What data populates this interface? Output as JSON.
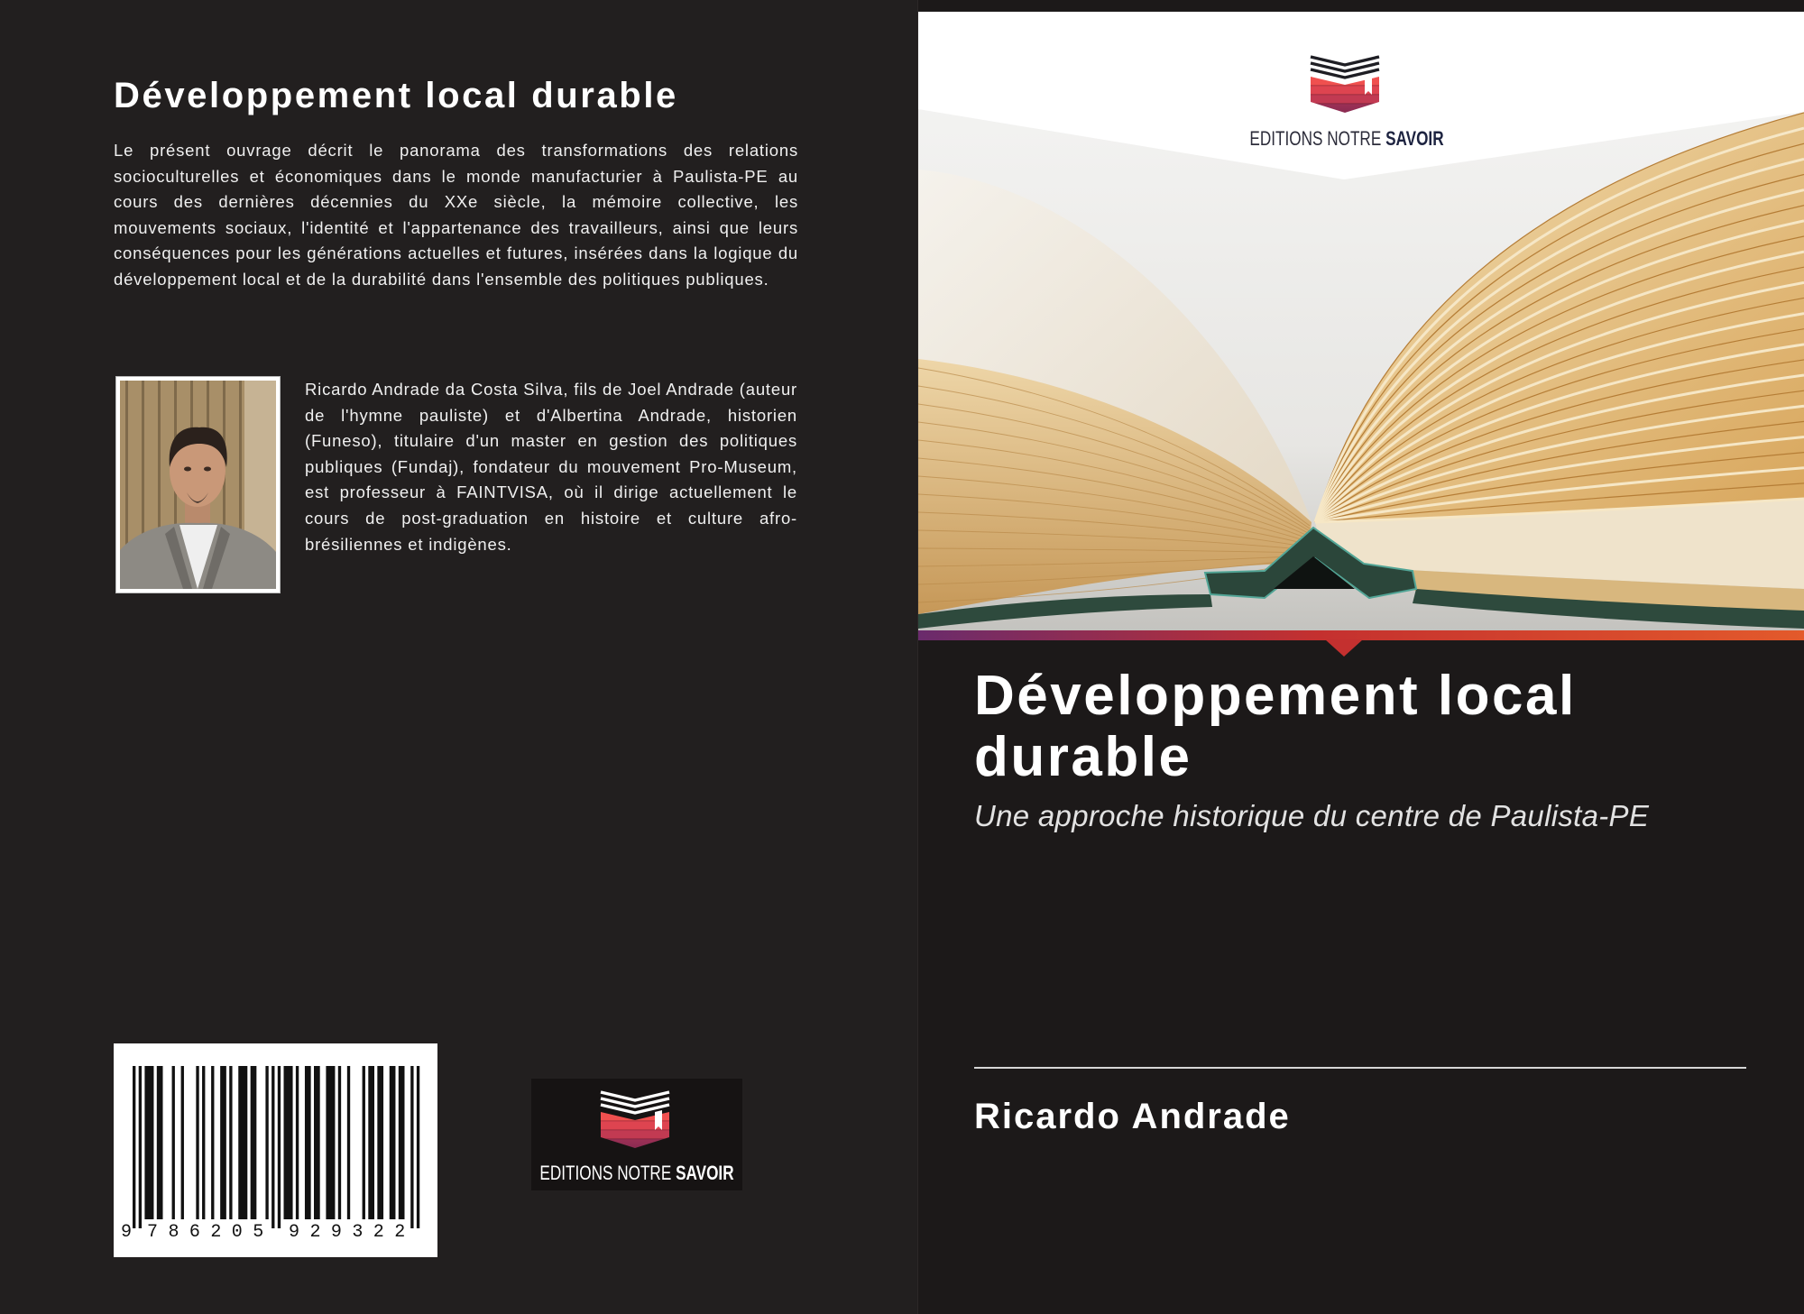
{
  "publisher": {
    "name_light": "EDITIONS NOTRE",
    "name_bold": "SAVOIR",
    "icon": "open-book-stack-icon"
  },
  "back_cover": {
    "title": "Développement local durable",
    "summary": "Le présent ouvrage décrit le panorama des transformations des relations socioculturelles et économiques dans le monde manufacturier à Paulista-PE au cours des dernières décennies du XXe siècle, la mémoire collective, les mouvements sociaux, l'identité et l'appartenance des travailleurs, ainsi que leurs conséquences pour les générations actuelles et futures, insérées dans la logique du développement local et de la durabilité dans l'ensemble des politiques publiques.",
    "author_bio": "Ricardo Andrade da Costa Silva, fils de Joel Andrade (auteur de l'hymne pauliste) et d'Albertina Andrade, historien (Funeso), titulaire d'un master en gestion des politiques publiques (Fundaj), fondateur du mouvement Pro-Museum, est professeur à FAINTVISA, où il dirige actuellement le cours de post-graduation en histoire et culture afro-brésiliennes et indigènes.",
    "barcode": {
      "first_digit": "9",
      "left_group": "786205",
      "right_group": "929322"
    }
  },
  "front_cover": {
    "title": "Développement local durable",
    "subtitle": "Une approche historique du centre de Paulista-PE",
    "author": "Ricardo Andrade"
  },
  "colors": {
    "back_bg": "#221f1f",
    "front_bg": "#1c1919",
    "text_light": "#f2f2f2",
    "stripe_start": "#6a2b6c",
    "stripe_mid": "#c4302f",
    "stripe_end": "#e35a2b"
  }
}
